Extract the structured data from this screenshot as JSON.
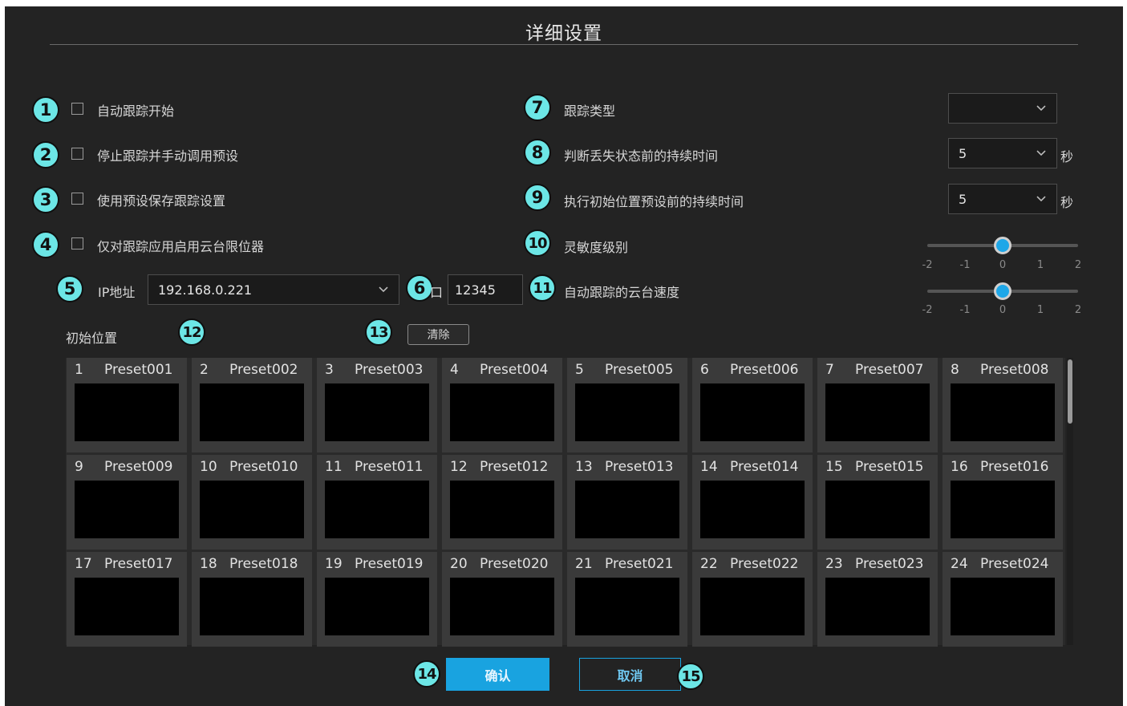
{
  "dialog": {
    "title": "详细设置"
  },
  "markers": [
    "1",
    "2",
    "3",
    "4",
    "5",
    "6",
    "7",
    "8",
    "9",
    "10",
    "11",
    "12",
    "13",
    "14",
    "15"
  ],
  "left": {
    "options": [
      {
        "label": "自动跟踪开始",
        "checked": false
      },
      {
        "label": "停止跟踪并手动调用预设",
        "checked": false
      },
      {
        "label": "使用预设保存跟踪设置",
        "checked": false
      },
      {
        "label": "仅对跟踪应用启用云台限位器",
        "checked": false
      }
    ],
    "ip_label": "IP地址",
    "ip_value": "192.168.0.221",
    "port_partial": "口",
    "port_value": "12345"
  },
  "right": {
    "tracking_type_label": "跟踪类型",
    "tracking_type_value": "",
    "lost_label": "判断丢失状态前的持续时间",
    "lost_value": "5",
    "initial_label": "执行初始位置预设前的持续时间",
    "initial_value": "5",
    "unit_seconds": "秒",
    "sensitivity_label": "灵敏度级别",
    "sensitivity_value": 0,
    "speed_label": "自动跟踪的云台速度",
    "speed_value": 0,
    "slider_ticks": [
      "-2",
      "-1",
      "0",
      "1",
      "2"
    ]
  },
  "presets": {
    "section_label": "初始位置",
    "clear_label": "清除",
    "items": [
      {
        "num": "1",
        "name": "Preset001"
      },
      {
        "num": "2",
        "name": "Preset002"
      },
      {
        "num": "3",
        "name": "Preset003"
      },
      {
        "num": "4",
        "name": "Preset004"
      },
      {
        "num": "5",
        "name": "Preset005"
      },
      {
        "num": "6",
        "name": "Preset006"
      },
      {
        "num": "7",
        "name": "Preset007"
      },
      {
        "num": "8",
        "name": "Preset008"
      },
      {
        "num": "9",
        "name": "Preset009"
      },
      {
        "num": "10",
        "name": "Preset010"
      },
      {
        "num": "11",
        "name": "Preset011"
      },
      {
        "num": "12",
        "name": "Preset012"
      },
      {
        "num": "13",
        "name": "Preset013"
      },
      {
        "num": "14",
        "name": "Preset014"
      },
      {
        "num": "15",
        "name": "Preset015"
      },
      {
        "num": "16",
        "name": "Preset016"
      },
      {
        "num": "17",
        "name": "Preset017"
      },
      {
        "num": "18",
        "name": "Preset018"
      },
      {
        "num": "19",
        "name": "Preset019"
      },
      {
        "num": "20",
        "name": "Preset020"
      },
      {
        "num": "21",
        "name": "Preset021"
      },
      {
        "num": "22",
        "name": "Preset022"
      },
      {
        "num": "23",
        "name": "Preset023"
      },
      {
        "num": "24",
        "name": "Preset024"
      }
    ]
  },
  "footer": {
    "confirm_label": "确认",
    "cancel_label": "取消"
  },
  "colors": {
    "accent": "#19a3e0",
    "marker": "#6ce6e6",
    "background": "#232323"
  }
}
